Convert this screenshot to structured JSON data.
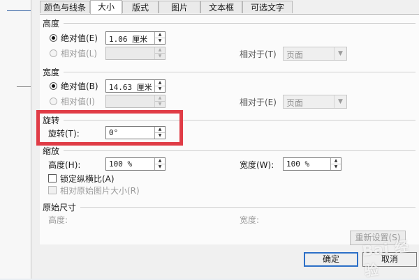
{
  "tabs": [
    "颜色与线条",
    "大小",
    "版式",
    "图片",
    "文本框",
    "可选文字"
  ],
  "active_tab": 1,
  "height_section": {
    "title": "高度",
    "absolute_label": "绝对值(E)",
    "absolute_value": "1.06 厘米",
    "relative_label": "相对值(L)",
    "relative_value": "",
    "relative_to_label": "相对于(T)",
    "relative_to_value": "页面"
  },
  "width_section": {
    "title": "宽度",
    "absolute_label": "绝对值(B)",
    "absolute_value": "14.63 厘米",
    "relative_label": "相对值(I)",
    "relative_value": "",
    "relative_to_label": "相对于(E)",
    "relative_to_value": "页面"
  },
  "rotation_section": {
    "title": "旋转",
    "rotation_label": "旋转(T):",
    "rotation_value": "0°"
  },
  "scale_section": {
    "title": "缩放",
    "height_label": "高度(H):",
    "height_value": "100 %",
    "width_label": "宽度(W):",
    "width_value": "100 %",
    "lock_aspect_label": "锁定纵横比(A)",
    "relative_original_label": "相对原始图片大小(R)"
  },
  "original_size_section": {
    "title": "原始尺寸",
    "height_label": "高度:",
    "width_label": "宽度:"
  },
  "buttons": {
    "reset": "重新设置(S)",
    "ok": "确定",
    "cancel": "取消"
  },
  "watermark": "Bai 经验",
  "colors": {
    "highlight_border": "#e03c46",
    "default_button_border": "#2c6fc7"
  }
}
